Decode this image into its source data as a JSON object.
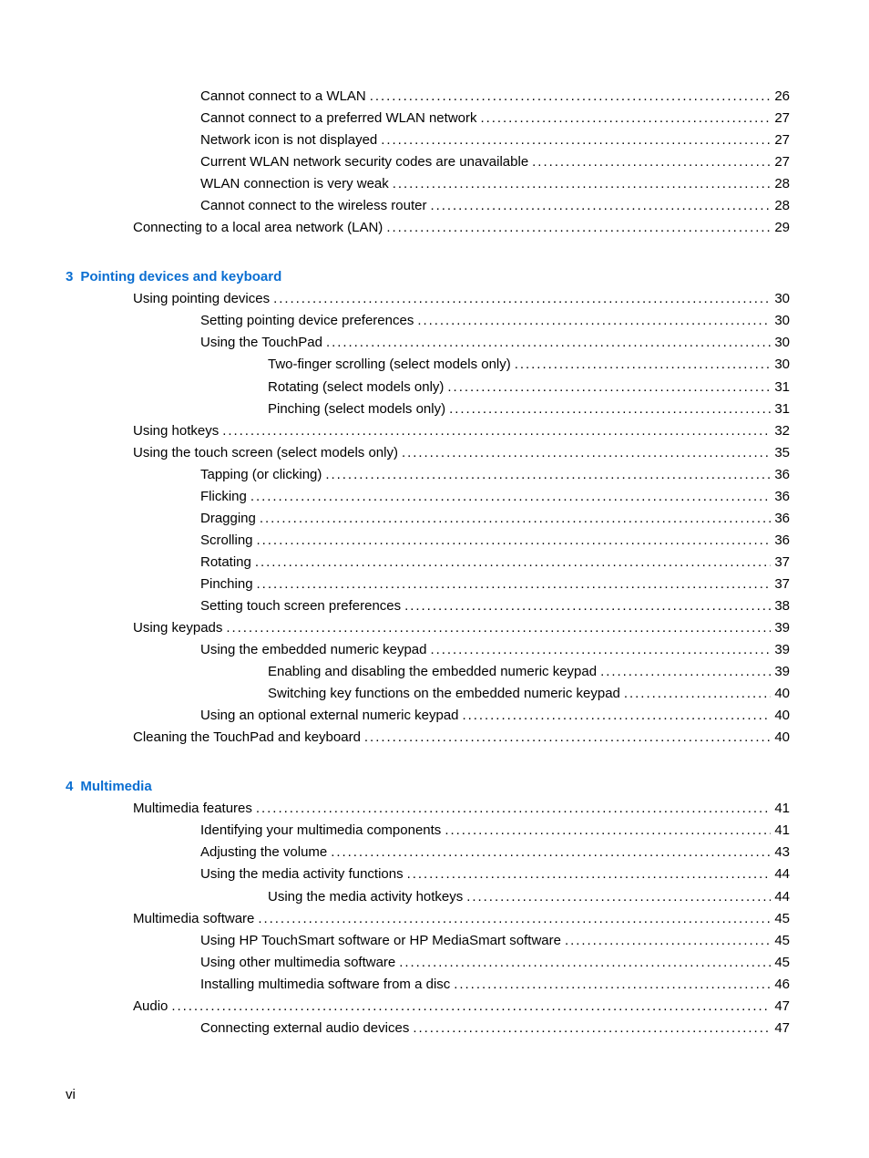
{
  "toc": {
    "continued_entries": [
      {
        "level": 2,
        "title": "Cannot connect to a WLAN",
        "page": "26"
      },
      {
        "level": 2,
        "title": "Cannot connect to a preferred WLAN network",
        "page": "27"
      },
      {
        "level": 2,
        "title": "Network icon is not displayed",
        "page": "27"
      },
      {
        "level": 2,
        "title": "Current WLAN network security codes are unavailable",
        "page": "27"
      },
      {
        "level": 2,
        "title": "WLAN connection is very weak",
        "page": "28"
      },
      {
        "level": 2,
        "title": "Cannot connect to the wireless router",
        "page": "28"
      },
      {
        "level": 1,
        "title": "Connecting to a local area network (LAN)",
        "page": "29"
      }
    ],
    "chapters": [
      {
        "number": "3",
        "title": "Pointing devices and keyboard",
        "entries": [
          {
            "level": 1,
            "title": "Using pointing devices",
            "page": "30"
          },
          {
            "level": 2,
            "title": "Setting pointing device preferences",
            "page": "30"
          },
          {
            "level": 2,
            "title": "Using the TouchPad",
            "page": "30"
          },
          {
            "level": 3,
            "title": "Two-finger scrolling (select models only)",
            "page": "30"
          },
          {
            "level": 3,
            "title": "Rotating (select models only)",
            "page": "31"
          },
          {
            "level": 3,
            "title": "Pinching (select models only)",
            "page": "31"
          },
          {
            "level": 1,
            "title": "Using hotkeys",
            "page": "32"
          },
          {
            "level": 1,
            "title": "Using the touch screen (select models only)",
            "page": "35"
          },
          {
            "level": 2,
            "title": "Tapping (or clicking)",
            "page": "36"
          },
          {
            "level": 2,
            "title": "Flicking",
            "page": "36"
          },
          {
            "level": 2,
            "title": "Dragging",
            "page": "36"
          },
          {
            "level": 2,
            "title": "Scrolling",
            "page": "36"
          },
          {
            "level": 2,
            "title": "Rotating",
            "page": "37"
          },
          {
            "level": 2,
            "title": "Pinching",
            "page": "37"
          },
          {
            "level": 2,
            "title": "Setting touch screen preferences",
            "page": "38"
          },
          {
            "level": 1,
            "title": "Using keypads",
            "page": "39"
          },
          {
            "level": 2,
            "title": "Using the embedded numeric keypad",
            "page": "39"
          },
          {
            "level": 3,
            "title": "Enabling and disabling the embedded numeric keypad",
            "page": "39"
          },
          {
            "level": 3,
            "title": "Switching key functions on the embedded numeric keypad",
            "page": "40"
          },
          {
            "level": 2,
            "title": "Using an optional external numeric keypad",
            "page": "40"
          },
          {
            "level": 1,
            "title": "Cleaning the TouchPad and keyboard",
            "page": "40"
          }
        ]
      },
      {
        "number": "4",
        "title": "Multimedia",
        "entries": [
          {
            "level": 1,
            "title": "Multimedia features",
            "page": "41"
          },
          {
            "level": 2,
            "title": "Identifying your multimedia components",
            "page": "41"
          },
          {
            "level": 2,
            "title": "Adjusting the volume",
            "page": "43"
          },
          {
            "level": 2,
            "title": "Using the media activity functions",
            "page": "44"
          },
          {
            "level": 3,
            "title": "Using the media activity hotkeys",
            "page": "44"
          },
          {
            "level": 1,
            "title": "Multimedia software",
            "page": "45"
          },
          {
            "level": 2,
            "title": "Using HP TouchSmart software or HP MediaSmart software",
            "page": "45"
          },
          {
            "level": 2,
            "title": "Using other multimedia software",
            "page": "45"
          },
          {
            "level": 2,
            "title": "Installing multimedia software from a disc",
            "page": "46"
          },
          {
            "level": 1,
            "title": "Audio",
            "page": "47"
          },
          {
            "level": 2,
            "title": "Connecting external audio devices",
            "page": "47"
          }
        ]
      }
    ]
  },
  "footer": {
    "page_number": "vi"
  },
  "colors": {
    "chapter_heading": "#0a6ed1"
  }
}
